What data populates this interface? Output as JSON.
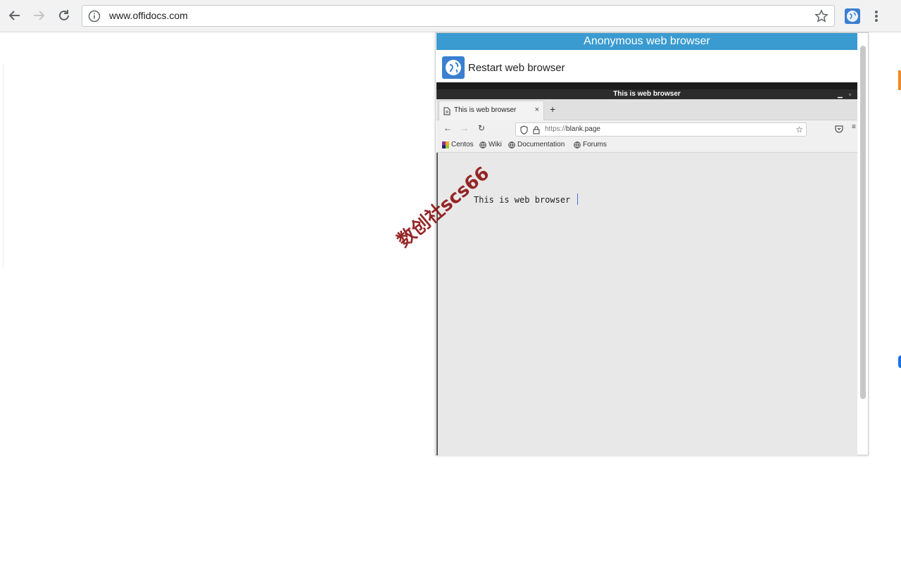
{
  "chrome": {
    "url": "www.offidocs.com"
  },
  "popup": {
    "header_title": "Anonymous web browser",
    "restart_label": "Restart web browser"
  },
  "remote_window": {
    "title": "This is web browser",
    "tab_title": "This is web browser",
    "new_tab_symbol": "+",
    "close_symbol": "×",
    "url_scheme": "https://",
    "url_host": "blank.page",
    "bookmarks": [
      "Centos",
      "Wiki",
      "Documentation",
      "Forums"
    ],
    "content_text": "This is web browser"
  },
  "watermark": {
    "text": "数创社scs66"
  },
  "colors": {
    "popup_header": "#3a9bd1",
    "watermark": "#8b1010"
  }
}
